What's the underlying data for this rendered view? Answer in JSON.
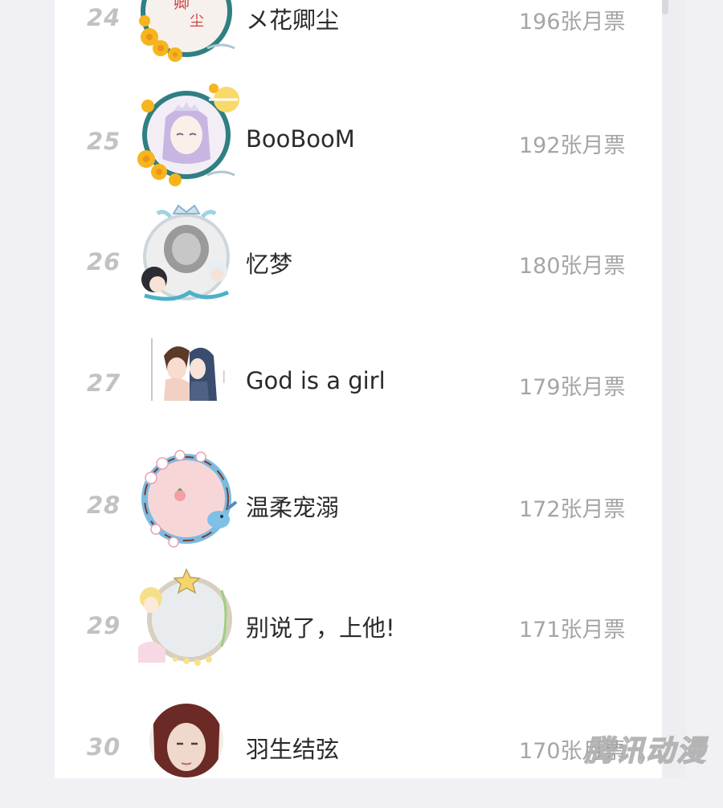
{
  "leaderboard": {
    "rows": [
      {
        "rank": "24",
        "name": "メ花卿尘",
        "tickets": "196张月票",
        "avatar": "avatar-flower-frame-icon"
      },
      {
        "rank": "25",
        "name": "BooBooM",
        "tickets": "192张月票",
        "avatar": "avatar-flower-frame-girl-icon"
      },
      {
        "rank": "26",
        "name": "忆梦",
        "tickets": "180张月票",
        "avatar": "avatar-crown-frame-icon"
      },
      {
        "rank": "27",
        "name": "God is a girl",
        "tickets": "179张月票",
        "avatar": "avatar-couple-icon"
      },
      {
        "rank": "28",
        "name": "温柔宠溺",
        "tickets": "172张月票",
        "avatar": "avatar-cherry-blossom-frame-icon"
      },
      {
        "rank": "29",
        "name": "别说了，上他!",
        "tickets": "171张月票",
        "avatar": "avatar-star-frame-icon"
      },
      {
        "rank": "30",
        "name": "羽生结弦",
        "tickets": "170张月票",
        "avatar": "avatar-portrait-icon"
      }
    ]
  },
  "watermark": "腾讯动漫"
}
